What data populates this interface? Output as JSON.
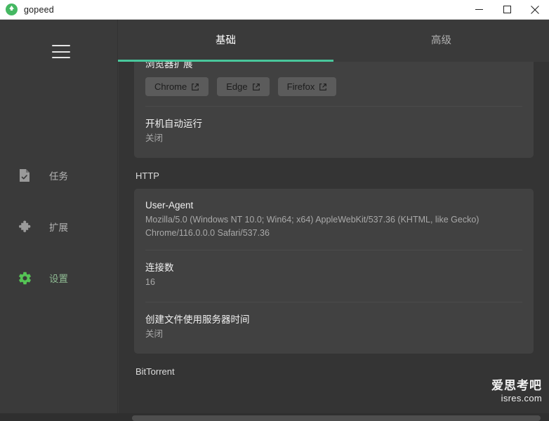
{
  "window": {
    "title": "gopeed",
    "logo_icon": "gopeed-logo-icon",
    "minimize_label": "—",
    "maximize_label": "□",
    "close_label": "✕",
    "accent_color": "#49c79c",
    "titlebar_bg": "#ffffff",
    "app_bg": "#3a3a3a",
    "card_bg": "#414141"
  },
  "sidebar": {
    "menu_icon": "hamburger-menu-icon",
    "items": [
      {
        "label": "任务",
        "icon": "task-document-icon",
        "active": false
      },
      {
        "label": "扩展",
        "icon": "puzzle-piece-icon",
        "active": false
      },
      {
        "label": "设置",
        "icon": "gear-icon",
        "active": true
      }
    ]
  },
  "tabs": [
    {
      "label": "基础",
      "active": true
    },
    {
      "label": "高级",
      "active": false
    }
  ],
  "content": {
    "browser_ext": {
      "title": "浏览器扩展",
      "buttons": [
        {
          "label": "Chrome",
          "icon": "external-link-icon"
        },
        {
          "label": "Edge",
          "icon": "external-link-icon"
        },
        {
          "label": "Firefox",
          "icon": "external-link-icon"
        }
      ]
    },
    "autostart": {
      "title": "开机自动运行",
      "value": "关闭"
    },
    "http_section": "HTTP",
    "user_agent": {
      "title": "User-Agent",
      "value": "Mozilla/5.0 (Windows NT 10.0; Win64; x64) AppleWebKit/537.36 (KHTML, like Gecko) Chrome/116.0.0.0 Safari/537.36"
    },
    "connections": {
      "title": "连接数",
      "value": "16"
    },
    "server_time": {
      "title": "创建文件使用服务器时间",
      "value": "关闭"
    },
    "bittorrent_section": "BitTorrent"
  },
  "watermark": {
    "cn": "爱思考吧",
    "en": "isres.com"
  }
}
